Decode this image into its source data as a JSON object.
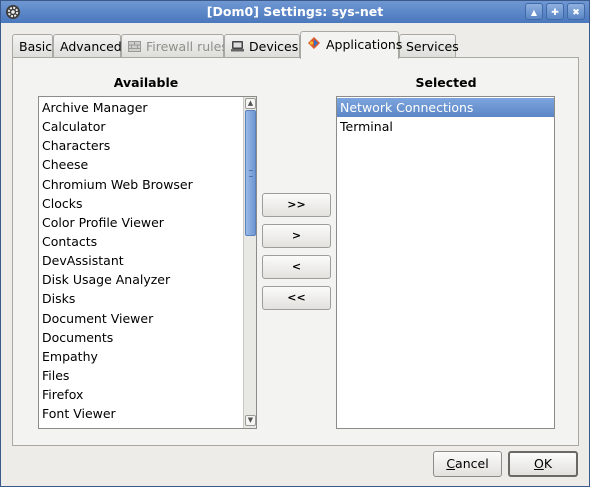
{
  "window": {
    "title": "[Dom0] Settings: sys-net"
  },
  "titlebar_buttons": {
    "minimize": "▲",
    "maximize": "✚",
    "close": "✖"
  },
  "tabs": [
    {
      "label": "Basic",
      "active": false,
      "disabled": false
    },
    {
      "label": "Advanced",
      "active": false,
      "disabled": false
    },
    {
      "label": "Firewall rules",
      "active": false,
      "disabled": true
    },
    {
      "label": "Devices",
      "active": false,
      "disabled": false
    },
    {
      "label": "Applications",
      "active": true,
      "disabled": false
    },
    {
      "label": "Services",
      "active": false,
      "disabled": false
    }
  ],
  "available": {
    "heading": "Available",
    "items": [
      "Archive Manager",
      "Calculator",
      "Characters",
      "Cheese",
      "Chromium Web Browser",
      "Clocks",
      "Color Profile Viewer",
      "Contacts",
      "DevAssistant",
      "Disk Usage Analyzer",
      "Disks",
      "Document Viewer",
      "Documents",
      "Empathy",
      "Files",
      "Firefox",
      "Font Viewer"
    ]
  },
  "selected": {
    "heading": "Selected",
    "items": [
      "Network Connections",
      "Terminal"
    ],
    "highlighted_index": 0
  },
  "move_buttons": {
    "add_all": ">>",
    "add": ">",
    "remove": "<",
    "remove_all": "<<"
  },
  "dialog_buttons": {
    "cancel": {
      "accel": "C",
      "rest": "ancel"
    },
    "ok": {
      "accel": "O",
      "rest": "K"
    }
  },
  "colors": {
    "titlebar": "#5a86c6",
    "selection": "#6b94d2",
    "scrollbar_thumb": "#7ea3dc"
  }
}
